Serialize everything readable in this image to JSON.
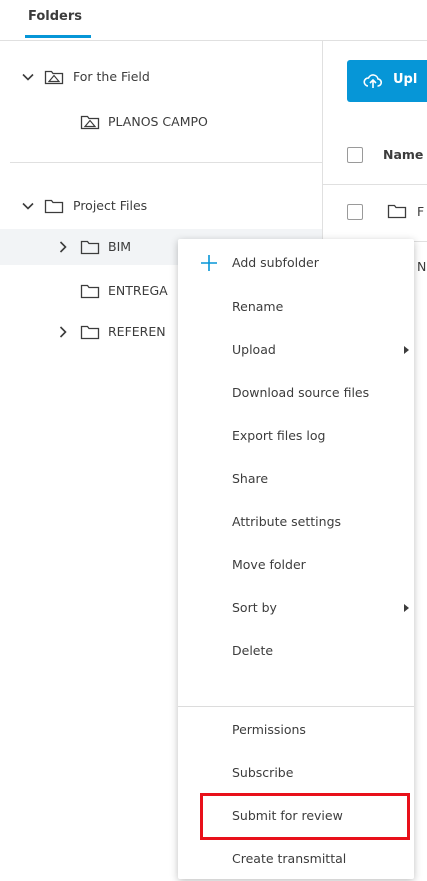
{
  "tabs": {
    "folders_label": "Folders"
  },
  "tree": {
    "field_section_label": "For the Field",
    "field_child_label": "PLANOS CAMPO",
    "project_section_label": "Project Files",
    "items": [
      {
        "label": "BIM"
      },
      {
        "label": "ENTREGA"
      },
      {
        "label": "REFEREN"
      }
    ]
  },
  "content": {
    "upload_label": "Upl",
    "name_header": "Name",
    "row1_text": "F",
    "row2_text": "N"
  },
  "context_menu": {
    "items": [
      {
        "label": "Add subfolder",
        "icon": "plus-icon"
      },
      {
        "label": "Rename"
      },
      {
        "label": "Upload",
        "submenu": true
      },
      {
        "label": "Download source files"
      },
      {
        "label": "Export files log"
      },
      {
        "label": "Share"
      },
      {
        "label": "Attribute settings"
      },
      {
        "label": "Move folder"
      },
      {
        "label": "Sort by",
        "submenu": true
      },
      {
        "label": "Delete"
      },
      {
        "label": "Permissions"
      },
      {
        "label": "Subscribe"
      },
      {
        "label": "Submit for review",
        "highlighted": true
      },
      {
        "label": "Create transmittal"
      }
    ]
  },
  "colors": {
    "accent": "#0696d7",
    "highlight_border": "#e8101a",
    "hover_row": "#f2f4f6"
  }
}
